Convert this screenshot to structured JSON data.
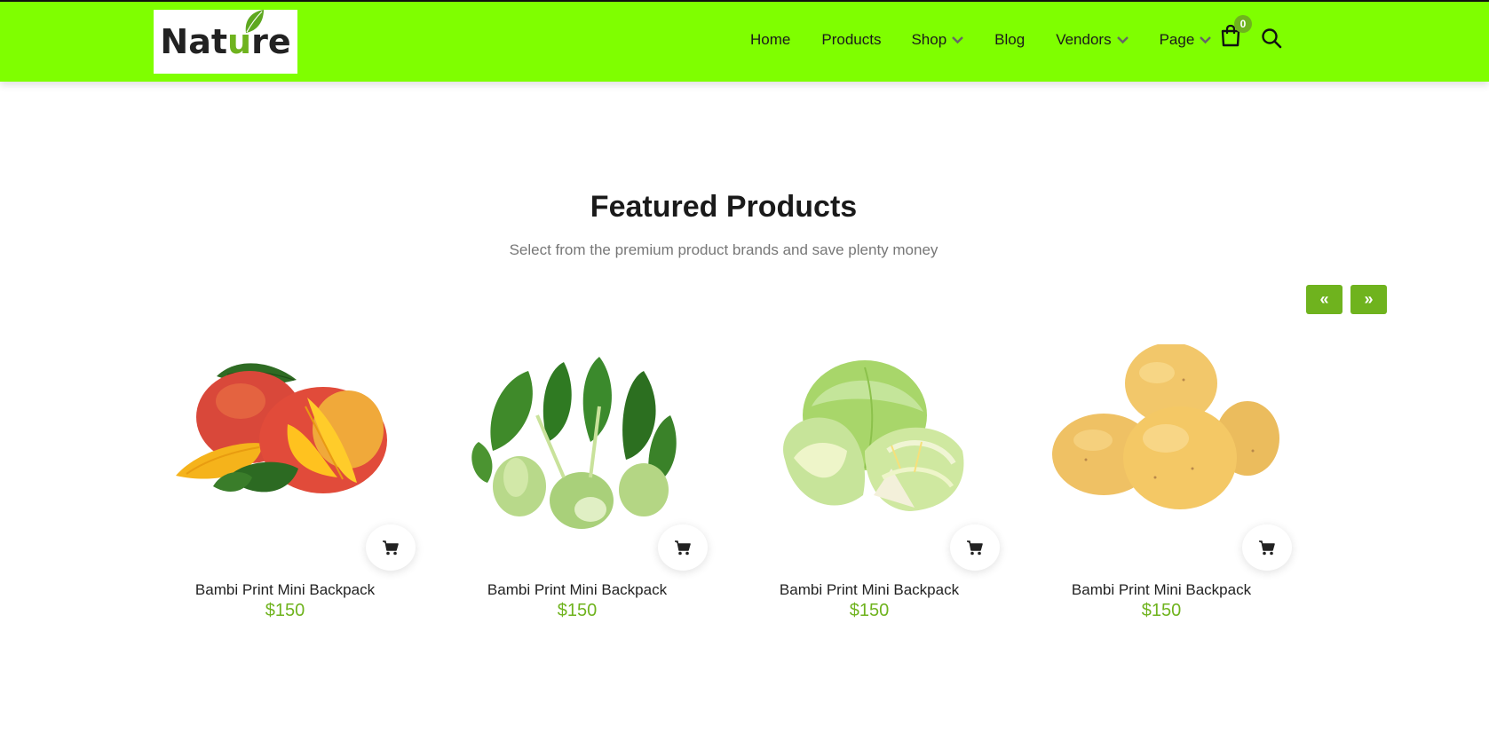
{
  "brand": {
    "logo_prefix": "Nat",
    "logo_u": "u",
    "logo_suffix": "re",
    "accent_color": "#7fff00",
    "green_color": "#6fb31e"
  },
  "nav": {
    "items": [
      {
        "label": "Home",
        "dropdown": false
      },
      {
        "label": "Products",
        "dropdown": false
      },
      {
        "label": "Shop",
        "dropdown": true
      },
      {
        "label": "Blog",
        "dropdown": false
      },
      {
        "label": "Vendors",
        "dropdown": true
      },
      {
        "label": "Page",
        "dropdown": true
      }
    ],
    "cart_count": "0",
    "cart_icon": "shopping-bag-icon",
    "search_icon": "search-icon"
  },
  "section": {
    "title": "Featured Products",
    "subtitle": "Select from the premium product brands and save plenty money",
    "prev_label": "«",
    "next_label": "»"
  },
  "products": [
    {
      "name": "Bambi Print Mini Backpack",
      "price": "$150",
      "image": "mango"
    },
    {
      "name": "Bambi Print Mini Backpack",
      "price": "$150",
      "image": "bok-choy"
    },
    {
      "name": "Bambi Print Mini Backpack",
      "price": "$150",
      "image": "cabbage"
    },
    {
      "name": "Bambi Print Mini Backpack",
      "price": "$150",
      "image": "potatoes"
    }
  ]
}
